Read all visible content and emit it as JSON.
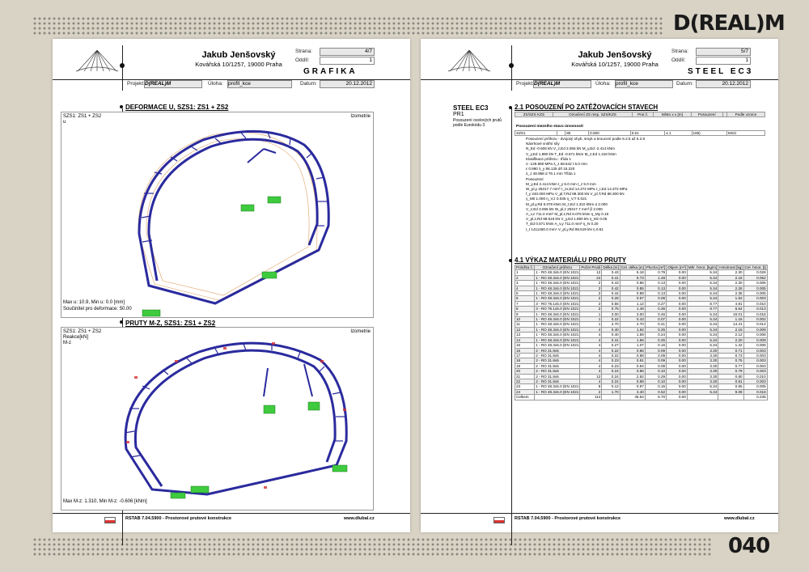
{
  "brand": "D(REAL)M",
  "page_number": "040",
  "left": {
    "name": "Jakub Jenšovský",
    "address": "Kovářská 10/1257, 19000 Praha",
    "strana_label": "Strana:",
    "strana_value": "4/7",
    "oddil_label": "Oddíl:",
    "oddil_value": "1",
    "section_title": "GRAFIKA",
    "projekt_label": "Projekt:",
    "projekt_value": "D(REAL)M",
    "uloha_label": "Úloha:",
    "uloha_value": "profil_kce",
    "datum_label": "Datum:",
    "datum_value": "20.12.2012",
    "fig1_title": "DEFORMACE U, SZS1: ZS1 + ZS2",
    "fig1_case": "SZS1: ZS1 + ZS2",
    "fig1_var": "u",
    "fig1_view": "Izometrie",
    "fig1_max": "Max u: 10.9, Min u: 0.0 [mm]",
    "fig1_factor": "Součinitel pro deformace: 50.00",
    "fig2_title": "PRUTY M-Z, SZS1: ZS1 + ZS2",
    "fig2_case": "SZS1: ZS1 + ZS2",
    "fig2_var1": "Reakce[kN]",
    "fig2_var2": "M-z",
    "fig2_view": "Izometrie",
    "fig2_max": "Max M-z: 1.310, Min M-z: -0.606 [kNm]",
    "footer_text": "RSTAB 7.04.5900 - Prostorové prutové konstrukce",
    "footer_url": "www.dlubal.cz"
  },
  "right": {
    "name": "Jakub Jenšovský",
    "address": "Kovářská 10/1257, 19000 Praha",
    "strana_label": "Strana:",
    "strana_value": "5/7",
    "oddil_label": "Oddíl:",
    "oddil_value": "1",
    "section_title": "STEEL EC3",
    "projekt_label": "Projekt:",
    "projekt_value": "D(REAL)M",
    "uloha_label": "Úloha:",
    "uloha_value": "profil_kce",
    "datum_label": "Datum:",
    "datum_value": "20.12.2012",
    "side_title": "STEEL EC3",
    "side_sub": "PR1",
    "side_desc": "Posouzení ocelových prutů podle Eurokódu 3",
    "sec21_title": "2.1 POSOUZENÍ PO ZATĚŽOVACÍCH STAVECH",
    "sec21_headers": [
      "ZS/SZS KZS",
      "Označení ZS resp. SZS/KZS",
      "Prut č.",
      "Místo x x [m]",
      "Posouzení",
      "",
      "Podle vzorce"
    ],
    "sec21_sub1": "Posouzení mezního stavu únosnosti",
    "sec21_row": [
      "SZS1",
      "",
      "80",
      "0.000",
      "0.61",
      "≤ 1",
      "166)",
      "MSÚ"
    ],
    "sec21_lines": [
      "Posouzení průřezu - dvojosý ohyb, smyk a kroucení podle 6.2.5 až 6.2.8",
      "Návrhové vnitřní síly",
      "N_Ed  -0.506 kN   V_z,Ed  3.055 kN   M_y,Ed  -2.414 kNm",
      "V_y,Ed  1.890 kN   T_Ed  -0.571 kNm   M_z,Ed  1.310 kNm",
      "Klasifikace průřezu - třída 1",
      "σ  -129.980 MPa   λ_z  68.542   t  5.0 mm",
      "ε  0.990   λ_y  88.125   d/t  15.220",
      "λ_1  48.958   d  76.1 mm   Třída  1",
      "Posouzení",
      "M_y,Ed  2.414 kNm   t_y  5.0 mm   t_z  5.0 mm",
      "W_pl,y  25317.7 mm³   τ_zx,Ed  14.372 MPa   τ_t,Ed  14.372 MPa",
      "f_y  240.000 MPa   V_pl,T,Rd  88.300 kN   V_pl,T,Rd  88.300 kN",
      "γ_M0  1.000   η_V,z  0.035   η_V,T  0.021",
      "M_pl,y,Rd  6.076 kNm   M_z,Ed  1.310 kNm   α  2.000",
      "V_z,Ed  3.055 kN   W_pl,z  25317.7 mm³   β  2.000",
      "A_v,z  711.0 mm²   M_pl,z,Rd  6.076 kNm   η_My  0.16",
      "V_pl,z,Rd  98.519 kN   V_y,Ed  1.890 kN   η_Mz  0.05",
      "T_Ed  0.571 kNm   A_v,y  711.0 mm²   η_N  0.20",
      "I_t  1411460.0 mm⁴   V_pl,y,Rd  98.519 kN   η  0.61"
    ],
    "sec41_title": "4.1 VÝKAZ MATERIÁLU PRO PRUTY",
    "sec41_headers": [
      "Položka č.",
      "Označení průřezu",
      "Počet Prutů",
      "Délka [m]",
      "Cel. délka [m]",
      "Plocha [m²]",
      "Objem [m³]",
      "Měr. hmot. [kg/m]",
      "Hmotnost [kg]",
      "Cel. hmot. [t]"
    ],
    "sec41_rows": [
      [
        "1",
        "1 - RO 48.3x5.0 (EN 1021",
        "12",
        "0.43",
        "5.18",
        "0.79",
        "0.00",
        "5.34",
        "2.30",
        "0.028"
      ],
      [
        "2",
        "1 - RO 48.3x5.0 (EN 1021",
        "24",
        "0.41",
        "9.73",
        "1.48",
        "0.00",
        "5.34",
        "2.16",
        "0.052"
      ],
      [
        "3",
        "1 - RO 48.3x5.0 (EN 1021",
        "2",
        "0.43",
        "0.86",
        "0.13",
        "0.00",
        "5.34",
        "2.30",
        "0.005"
      ],
      [
        "4",
        "1 - RO 48.3x5.0 (EN 1021",
        "2",
        "0.42",
        "0.85",
        "0.13",
        "0.00",
        "5.34",
        "2.26",
        "0.005"
      ],
      [
        "5",
        "1 - RO 48.3x5.0 (EN 1021",
        "2",
        "0.44",
        "0.88",
        "0.13",
        "0.00",
        "5.34",
        "2.35",
        "0.005"
      ],
      [
        "6",
        "1 - RO 48.3x5.0 (EN 1021",
        "2",
        "0.28",
        "0.57",
        "0.09",
        "0.00",
        "5.34",
        "1.52",
        "0.003"
      ],
      [
        "7",
        "3 - RO 76.1x5.0 (EN 1021",
        "2",
        "0.56",
        "1.12",
        "0.27",
        "0.00",
        "8.77",
        "4.91",
        "0.010"
      ],
      [
        "8",
        "3 - RO 76.1x5.0 (EN 1021",
        "2",
        "0.75",
        "1.49",
        "0.36",
        "0.00",
        "8.77",
        "6.54",
        "0.013"
      ],
      [
        "9",
        "1 - RO 48.3x5.0 (EN 1021",
        "1",
        "3.00",
        "3.00",
        "0.46",
        "0.00",
        "5.34",
        "16.01",
        "0.016"
      ],
      [
        "10",
        "1 - RO 48.3x5.0 (EN 1021",
        "1",
        "0.22",
        "0.43",
        "0.07",
        "0.00",
        "5.34",
        "1.16",
        "0.002"
      ],
      [
        "11",
        "1 - RO 48.3x5.0 (EN 1021",
        "1",
        "2.70",
        "2.70",
        "0.41",
        "0.00",
        "5.34",
        "14.41",
        "0.014"
      ],
      [
        "12",
        "1 - RO 48.3x5.0 (EN 1021",
        "4",
        "0.40",
        "1.62",
        "0.25",
        "0.00",
        "5.34",
        "2.16",
        "0.009"
      ],
      [
        "13",
        "1 - RO 48.3x5.0 (EN 1021",
        "4",
        "0.40",
        "1.59",
        "0.24",
        "0.00",
        "5.34",
        "2.12",
        "0.008"
      ],
      [
        "14",
        "1 - RO 48.3x5.0 (EN 1021",
        "4",
        "0.41",
        "1.65",
        "0.25",
        "0.00",
        "5.34",
        "2.20",
        "0.009"
      ],
      [
        "15",
        "1 - RO 48.3x5.0 (EN 1021",
        "4",
        "0.27",
        "1.07",
        "0.16",
        "0.00",
        "5.34",
        "1.42",
        "0.006"
      ],
      [
        "16",
        "2 - RO 31.8x5",
        "4",
        "0.22",
        "0.86",
        "0.09",
        "0.00",
        "3.30",
        "0.71",
        "0.003"
      ],
      [
        "17",
        "2 - RO 31.8x5",
        "4",
        "0.22",
        "0.88",
        "0.09",
        "0.00",
        "3.30",
        "0.73",
        "0.003"
      ],
      [
        "18",
        "2 - RO 31.8x5",
        "4",
        "0.23",
        "0.91",
        "0.09",
        "0.00",
        "3.30",
        "0.75",
        "0.003"
      ],
      [
        "19",
        "2 - RO 31.8x5",
        "4",
        "0.23",
        "0.94",
        "0.09",
        "0.00",
        "3.30",
        "0.77",
        "0.003"
      ],
      [
        "20",
        "2 - RO 31.8x5",
        "4",
        "0.24",
        "0.96",
        "0.10",
        "0.00",
        "3.30",
        "0.79",
        "0.003"
      ],
      [
        "21",
        "2 - RO 31.8x5",
        "12",
        "0.24",
        "2.92",
        "0.29",
        "0.00",
        "3.30",
        "0.80",
        "0.010"
      ],
      [
        "22",
        "2 - RO 31.8x5",
        "4",
        "0.24",
        "0.98",
        "0.10",
        "0.00",
        "3.30",
        "0.81",
        "0.003"
      ],
      [
        "23",
        "1 - RO 48.3x5.0 (EN 1021",
        "8",
        "0.12",
        "0.97",
        "0.15",
        "0.00",
        "5.34",
        "0.65",
        "0.005"
      ],
      [
        "24",
        "1 - RO 48.3x5.0 (EN 1021",
        "2",
        "1.70",
        "3.40",
        "0.52",
        "0.00",
        "5.34",
        "9.08",
        "0.018"
      ]
    ],
    "sec41_total": [
      "Celkem",
      "",
      "114",
      "",
      "45.54",
      "6.70",
      "0.00",
      "",
      "",
      "0.235"
    ],
    "footer_text": "RSTAB 7.04.5900 - Prostorové prutové konstrukce",
    "footer_url": "www.dlubal.cz"
  },
  "colors": {
    "beam": "#2a2a9e",
    "support": "#3ecb3e",
    "deformed": "#e0a060",
    "moment": "#d83030"
  }
}
